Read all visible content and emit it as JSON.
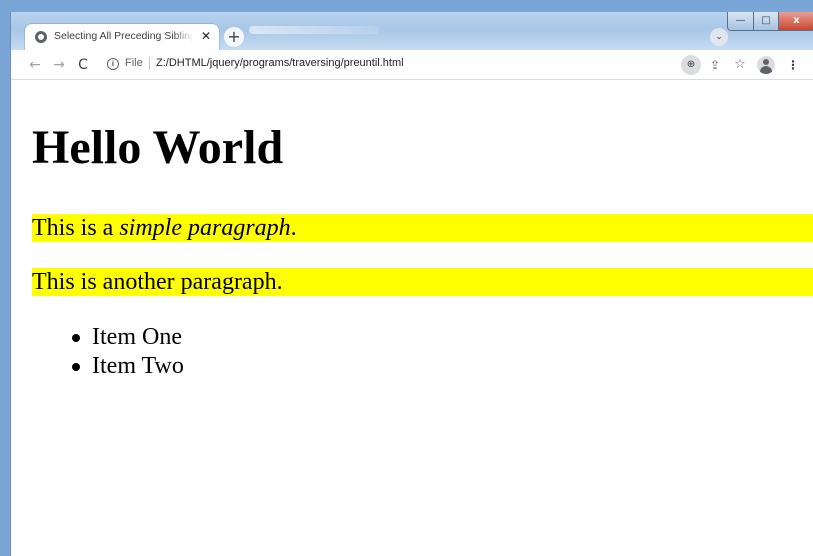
{
  "browser": {
    "tab": {
      "title": "Selecting All Preceding Siblings Until",
      "close_glyph": "✕"
    },
    "new_tab_glyph": "+",
    "tab_search_glyph": "⌄",
    "window_controls": {
      "minimize_glyph": "—",
      "maximize_glyph": "□",
      "close_glyph": "x"
    },
    "nav": {
      "back_glyph": "←",
      "forward_glyph": "→",
      "reload_glyph": "C"
    },
    "address": {
      "info_glyph": "i",
      "scheme_label": "File",
      "url": "Z:/DHTML/jquery/programs/traversing/preuntil.html"
    },
    "toolbar_icons": {
      "zoom_glyph": "⊕",
      "share_glyph": "⇪",
      "star_glyph": "☆",
      "menu_glyph": "⋮"
    }
  },
  "page": {
    "heading": "Hello World",
    "paragraph1": {
      "prefix": "This is a ",
      "emphasis": "simple paragraph",
      "suffix": "."
    },
    "paragraph2": "This is another paragraph.",
    "list_items": [
      "Item One",
      "Item Two"
    ]
  },
  "colors": {
    "highlight": "#ffff00",
    "aero_frame": "#a8c6e6",
    "close_button": "#c9452f"
  }
}
